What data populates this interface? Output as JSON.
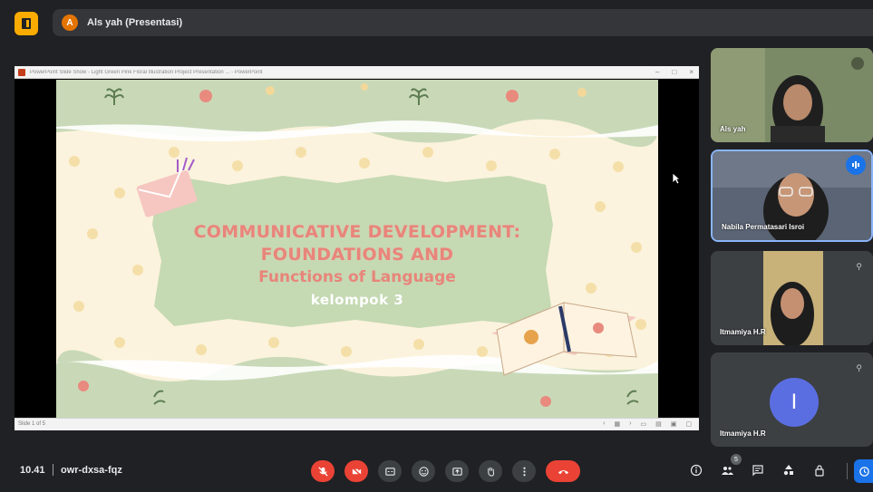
{
  "topbar": {
    "presenter_initial": "A",
    "presenter_label": "Als yah (Presentasi)",
    "app_icon": "meeting-room-icon",
    "app_color": "#f9ab00"
  },
  "presentation": {
    "window_title": "PowerPoint Slide Show - Light Green Pink Floral Illustration Project Presentation ... - PowerPoint",
    "slide_number": "Slide 1 of 5",
    "slide": {
      "line1": "COMMUNICATIVE DEVELOPMENT:",
      "line2": "FOUNDATIONS AND",
      "line3": "Functions of Language",
      "line4": "kelompok 3"
    }
  },
  "participants": [
    {
      "name": "Als yah",
      "icon": "more-options-icon"
    },
    {
      "name": "Nabila Permatasari Isroi",
      "icon": "speaking-icon"
    },
    {
      "name": "Itmamiya H.R",
      "icon": "pin-icon"
    },
    {
      "name": "Itmamiya H.R",
      "initial": "I",
      "icon": "pin-icon"
    }
  ],
  "bottombar": {
    "time": "10.41",
    "meeting_code": "owr-dxsa-fqz",
    "people_count": "5"
  },
  "colors": {
    "background": "#202124",
    "accent_red": "#ea4335",
    "accent_blue": "#1a73e8",
    "slide_green": "#c9d9b8",
    "slide_title": "#e8857a"
  }
}
